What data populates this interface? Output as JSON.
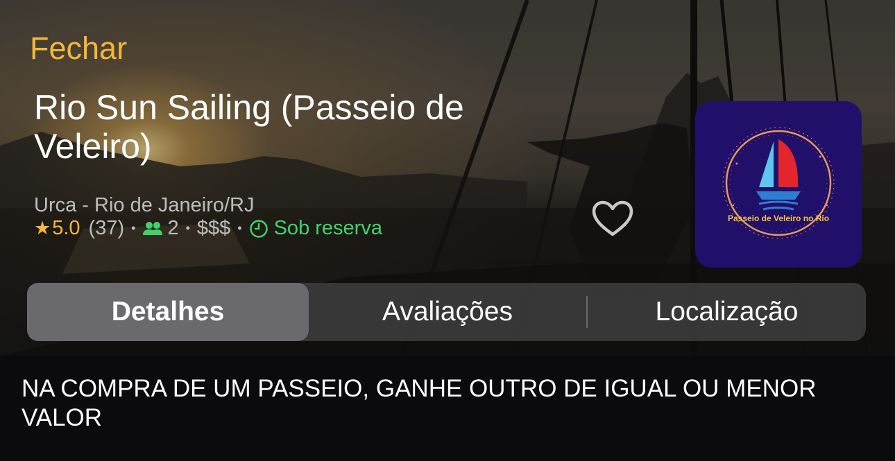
{
  "header": {
    "close_label": "Fechar",
    "title": "Rio Sun Sailing (Passeio de Veleiro)",
    "location": "Urca - Rio de Janeiro/RJ"
  },
  "meta": {
    "star": "★",
    "rating": "5.0",
    "reviews_count": "(37)",
    "people": "2",
    "price": "$$$",
    "availability": "Sob reserva",
    "separator": "•"
  },
  "logo": {
    "text": "Passeio de Veleiro no Rio"
  },
  "tabs": [
    {
      "label": "Detalhes",
      "active": true
    },
    {
      "label": "Avaliações",
      "active": false
    },
    {
      "label": "Localização",
      "active": false
    }
  ],
  "promo": {
    "text": "NA COMPRA DE UM PASSEIO, GANHE OUTRO DE IGUAL OU MENOR VALOR"
  },
  "colors": {
    "accent": "#f5b73a",
    "available": "#3fd46a",
    "logo_bg": "#21106a"
  },
  "icons": {
    "favorite": "heart-outline-icon",
    "people": "people-icon",
    "clock": "clock-icon",
    "star": "star-icon"
  }
}
